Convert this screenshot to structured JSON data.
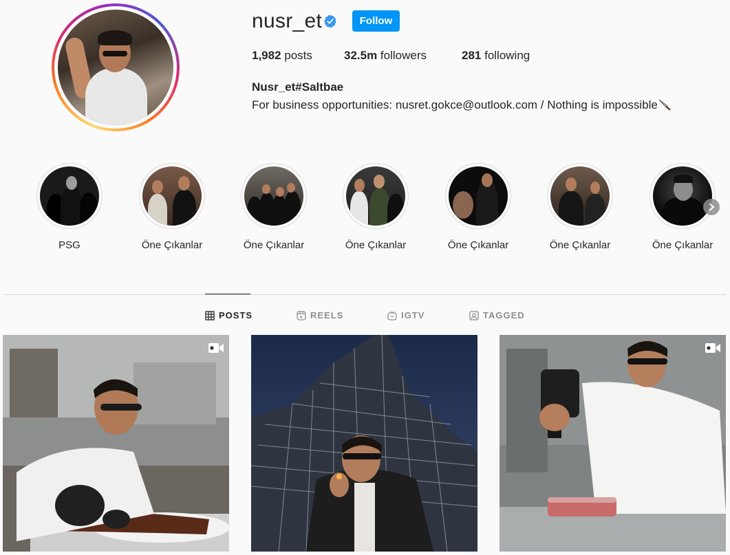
{
  "profile": {
    "username": "nusr_et",
    "verified": true,
    "follow_label": "Follow",
    "stats": {
      "posts_count": "1,982",
      "posts_label": " posts",
      "followers_count": "32.5m",
      "followers_label": " followers",
      "following_count": "281",
      "following_label": " following"
    },
    "full_name": "Nusr_et#Saltbae",
    "bio": "For business opportunities: nusret.gokce@outlook.com / Nothing is impossible"
  },
  "highlights": [
    {
      "label": "PSG"
    },
    {
      "label": "Öne Çıkanlar"
    },
    {
      "label": "Öne Çıkanlar"
    },
    {
      "label": "Öne Çıkanlar"
    },
    {
      "label": "Öne Çıkanlar"
    },
    {
      "label": "Öne Çıkanlar"
    },
    {
      "label": "Öne Çıkanlar"
    }
  ],
  "tabs": [
    {
      "label": "POSTS",
      "icon": "grid-icon",
      "active": true
    },
    {
      "label": "REELS",
      "icon": "reels-icon",
      "active": false
    },
    {
      "label": "IGTV",
      "icon": "igtv-icon",
      "active": false
    },
    {
      "label": "TAGGED",
      "icon": "tagged-icon",
      "active": false
    }
  ],
  "posts": [
    {
      "type": "video",
      "icon": "video-icon"
    },
    {
      "type": "image"
    },
    {
      "type": "video",
      "icon": "video-icon"
    }
  ],
  "colors": {
    "accent": "#0095f6",
    "verified_badge": "#3897f0",
    "text": "#262626",
    "muted": "#8e8e8e",
    "background": "#fafafa"
  }
}
